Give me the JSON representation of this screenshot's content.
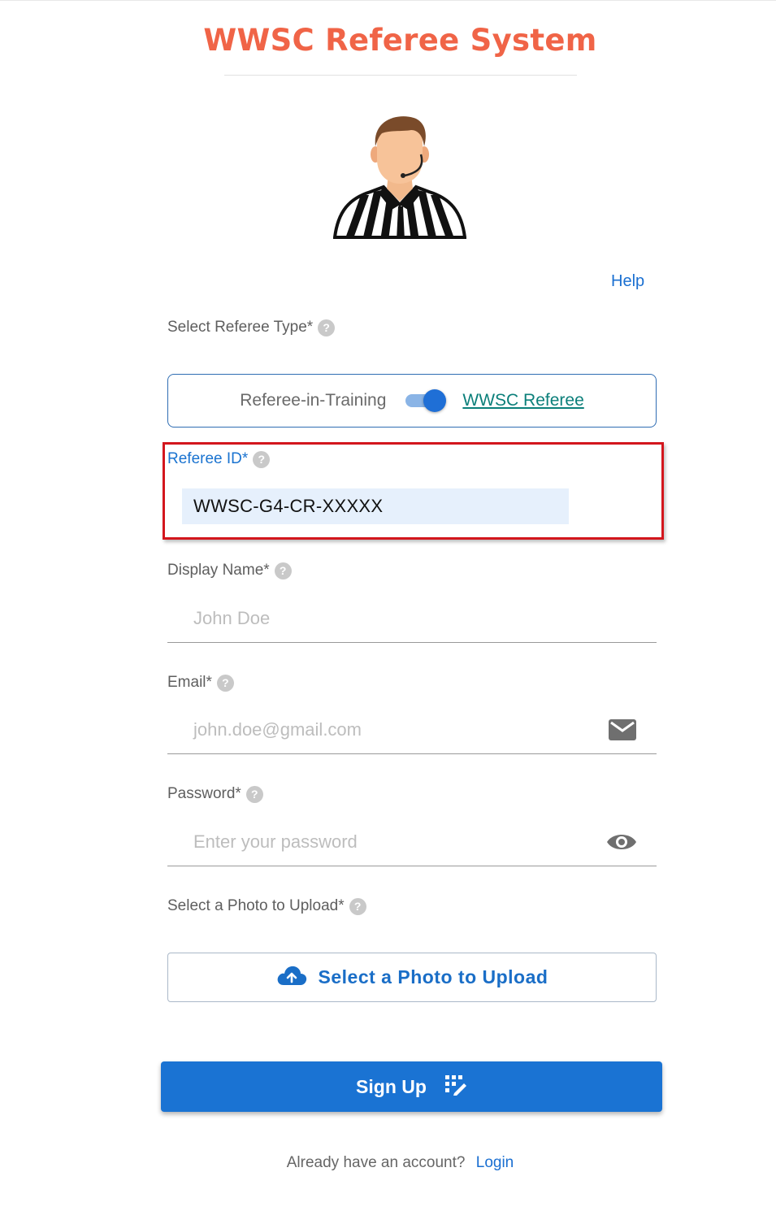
{
  "header": {
    "title": "WWSC Referee System"
  },
  "help": {
    "label": "Help"
  },
  "referee_type": {
    "label": "Select Referee Type*",
    "left_option": "Referee-in-Training",
    "right_option": "WWSC Referee",
    "selected": "WWSC Referee"
  },
  "referee_id": {
    "label": "Referee ID*",
    "value": "WWSC-G4-CR-XXXXX"
  },
  "display_name": {
    "label": "Display Name*",
    "placeholder": "John Doe"
  },
  "email": {
    "label": "Email*",
    "placeholder": "john.doe@gmail.com",
    "icon": "mail-icon"
  },
  "password": {
    "label": "Password*",
    "placeholder": "Enter your password",
    "icon": "eye-icon"
  },
  "photo": {
    "label": "Select a Photo to Upload*",
    "button_label": "Select a Photo to Upload",
    "icon": "cloud-upload-icon"
  },
  "signup": {
    "label": "Sign Up",
    "icon": "signup-icon"
  },
  "footer": {
    "question": "Already have an account?",
    "login_label": "Login"
  },
  "help_badge": "?",
  "colors": {
    "title": "#f06447",
    "primary": "#1a73d3",
    "link": "#1a6fd1",
    "highlight": "#d3161d",
    "teal": "#0b7f7a"
  }
}
